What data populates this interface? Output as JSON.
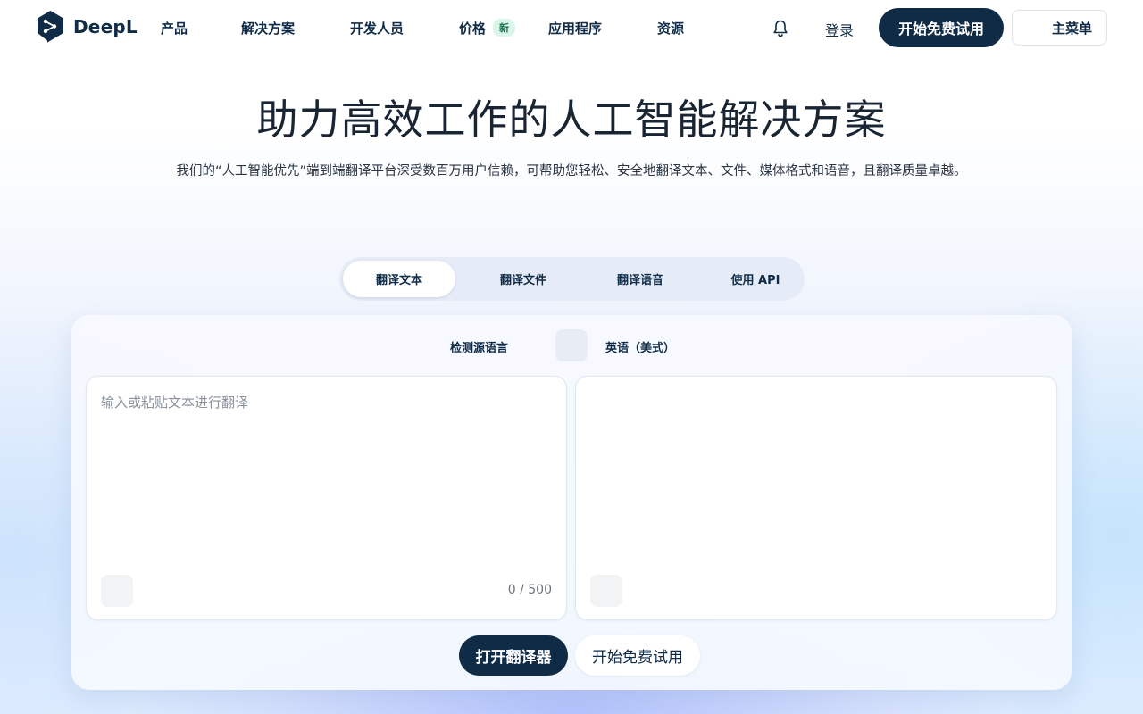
{
  "header": {
    "logo_text": "DeepL",
    "logo_icon": "deepl-logo",
    "nav": [
      {
        "label": "产品"
      },
      {
        "label": "解决方案"
      },
      {
        "label": "开发人员"
      },
      {
        "label": "价格",
        "badge": "新"
      },
      {
        "label": "应用程序"
      },
      {
        "label": "资源"
      }
    ],
    "bell_icon": "bell-icon",
    "login_label": "登录",
    "trial_label": "开始免费试用",
    "menu_label": "主菜单"
  },
  "hero": {
    "title": "助力高效工作的人工智能解决方案",
    "subtitle": "我们的“人工智能优先”端到端翻译平台深受数百万用户信赖，可帮助您轻松、安全地翻译文本、文件、媒体格式和语音，且翻译质量卓越。"
  },
  "tabs": [
    {
      "label": "翻译文本",
      "active": true
    },
    {
      "label": "翻译文件",
      "active": false
    },
    {
      "label": "翻译语音",
      "active": false
    },
    {
      "label": "使用 API",
      "active": false
    }
  ],
  "translator": {
    "source_lang": "检测源语言",
    "target_lang": "英语（美式）",
    "input_placeholder": "输入或粘贴文本进行翻译",
    "input_value": "",
    "char_count": "0 / 500",
    "open_button": "打开翻译器",
    "trial_button": "开始免费试用"
  },
  "colors": {
    "brand_dark": "#0f2b46",
    "badge_bg": "#d9f6e9",
    "badge_text": "#0e6b4a"
  }
}
